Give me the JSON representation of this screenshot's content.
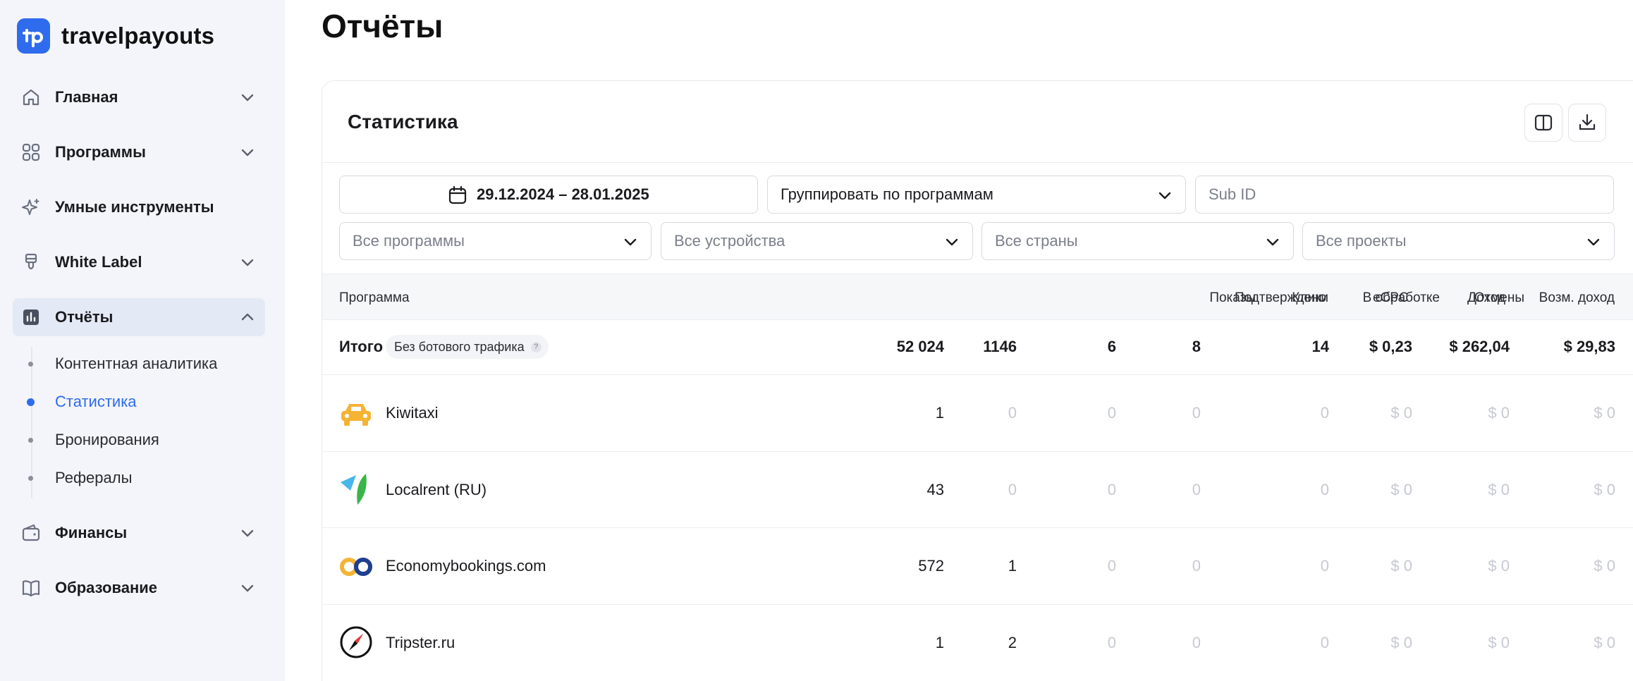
{
  "brand": {
    "name": "travelpayouts",
    "color": "#2f6bed"
  },
  "sidebar": {
    "items": [
      {
        "label": "Главная",
        "icon": "home-icon",
        "expandable": true
      },
      {
        "label": "Программы",
        "icon": "grid-icon",
        "expandable": true
      },
      {
        "label": "Умные инструменты",
        "icon": "sparkle-icon",
        "expandable": false
      },
      {
        "label": "White Label",
        "icon": "brush-icon",
        "expandable": true
      },
      {
        "label": "Отчёты",
        "icon": "chart-icon",
        "expandable": true,
        "active": true
      },
      {
        "label": "Финансы",
        "icon": "wallet-icon",
        "expandable": true
      },
      {
        "label": "Образование",
        "icon": "book-icon",
        "expandable": true
      }
    ],
    "reports_submenu": [
      {
        "label": "Контентная аналитика"
      },
      {
        "label": "Статистика",
        "active": true
      },
      {
        "label": "Бронирования"
      },
      {
        "label": "Рефералы"
      }
    ]
  },
  "page": {
    "title": "Отчёты"
  },
  "card": {
    "title": "Статистика"
  },
  "filters": {
    "date_range": "29.12.2024 – 28.01.2025",
    "group_by": "Группировать по программам",
    "subid_placeholder": "Sub ID",
    "programs": "Все программы",
    "devices": "Все устройства",
    "countries": "Все страны",
    "projects": "Все проекты"
  },
  "table": {
    "columns": [
      "Программа",
      "Показы",
      "Клики",
      "В обработке",
      "Отмены",
      "Подтверждено",
      "eCPC",
      "Доход",
      "Возм. доход"
    ],
    "total": {
      "label": "Итого",
      "badge": "Без ботового трафика",
      "badge_hint": "?",
      "values": [
        "52 024",
        "1146",
        "6",
        "8",
        "14",
        "$ 0,23",
        "$ 262,04",
        "$ 29,83"
      ]
    },
    "rows": [
      {
        "name": "Kiwitaxi",
        "logo": "taxi-logo-icon",
        "values": [
          "1",
          "0",
          "0",
          "0",
          "0",
          "$ 0",
          "$ 0",
          "$ 0"
        ]
      },
      {
        "name": "Localrent (RU)",
        "logo": "localrent-logo-icon",
        "values": [
          "43",
          "0",
          "0",
          "0",
          "0",
          "$ 0",
          "$ 0",
          "$ 0"
        ]
      },
      {
        "name": "Economybookings.com",
        "logo": "economybookings-logo-icon",
        "values": [
          "572",
          "1",
          "0",
          "0",
          "0",
          "$ 0",
          "$ 0",
          "$ 0"
        ]
      },
      {
        "name": "Tripster.ru",
        "logo": "tripster-logo-icon",
        "values": [
          "1",
          "2",
          "0",
          "0",
          "0",
          "$ 0",
          "$ 0",
          "$ 0"
        ]
      }
    ]
  }
}
